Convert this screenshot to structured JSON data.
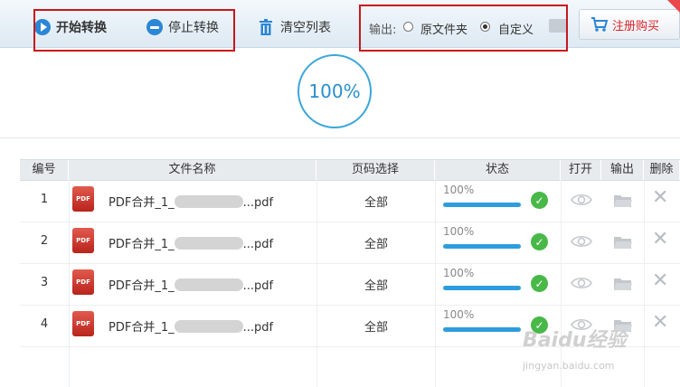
{
  "toolbar": {
    "start_label": "开始转换",
    "stop_label": "停止转换",
    "clear_label": "清空列表",
    "output_label": "输出:",
    "output_options": [
      "原文件夹",
      "自定义"
    ],
    "output_selected": "自定义",
    "buy_label": "注册购买"
  },
  "overall_progress": "100%",
  "table": {
    "headers": [
      "编号",
      "文件名称",
      "页码选择",
      "状态",
      "打开",
      "输出",
      "删除"
    ],
    "rows": [
      {
        "num": "1",
        "name_prefix": "PDF合并_1_",
        "name_suffix": "...pdf",
        "pages": "全部",
        "status_text": "100%",
        "progress": 1.0
      },
      {
        "num": "2",
        "name_prefix": "PDF合并_1_",
        "name_suffix": "...pdf",
        "pages": "全部",
        "status_text": "100%",
        "progress": 1.0
      },
      {
        "num": "3",
        "name_prefix": "PDF合并_1_",
        "name_suffix": "...pdf",
        "pages": "全部",
        "status_text": "100%",
        "progress": 1.0
      },
      {
        "num": "4",
        "name_prefix": "PDF合并_1_",
        "name_suffix": "...pdf",
        "pages": "全部",
        "status_text": "100%",
        "progress": 1.0
      }
    ]
  },
  "pdf_icon_text": "PDF",
  "watermark": {
    "line1": "Baidu经验",
    "line2": "jingyan.baidu.com"
  },
  "colors": {
    "accent": "#2b86d6",
    "highlight_box": "#c8161d",
    "success": "#48b848"
  }
}
